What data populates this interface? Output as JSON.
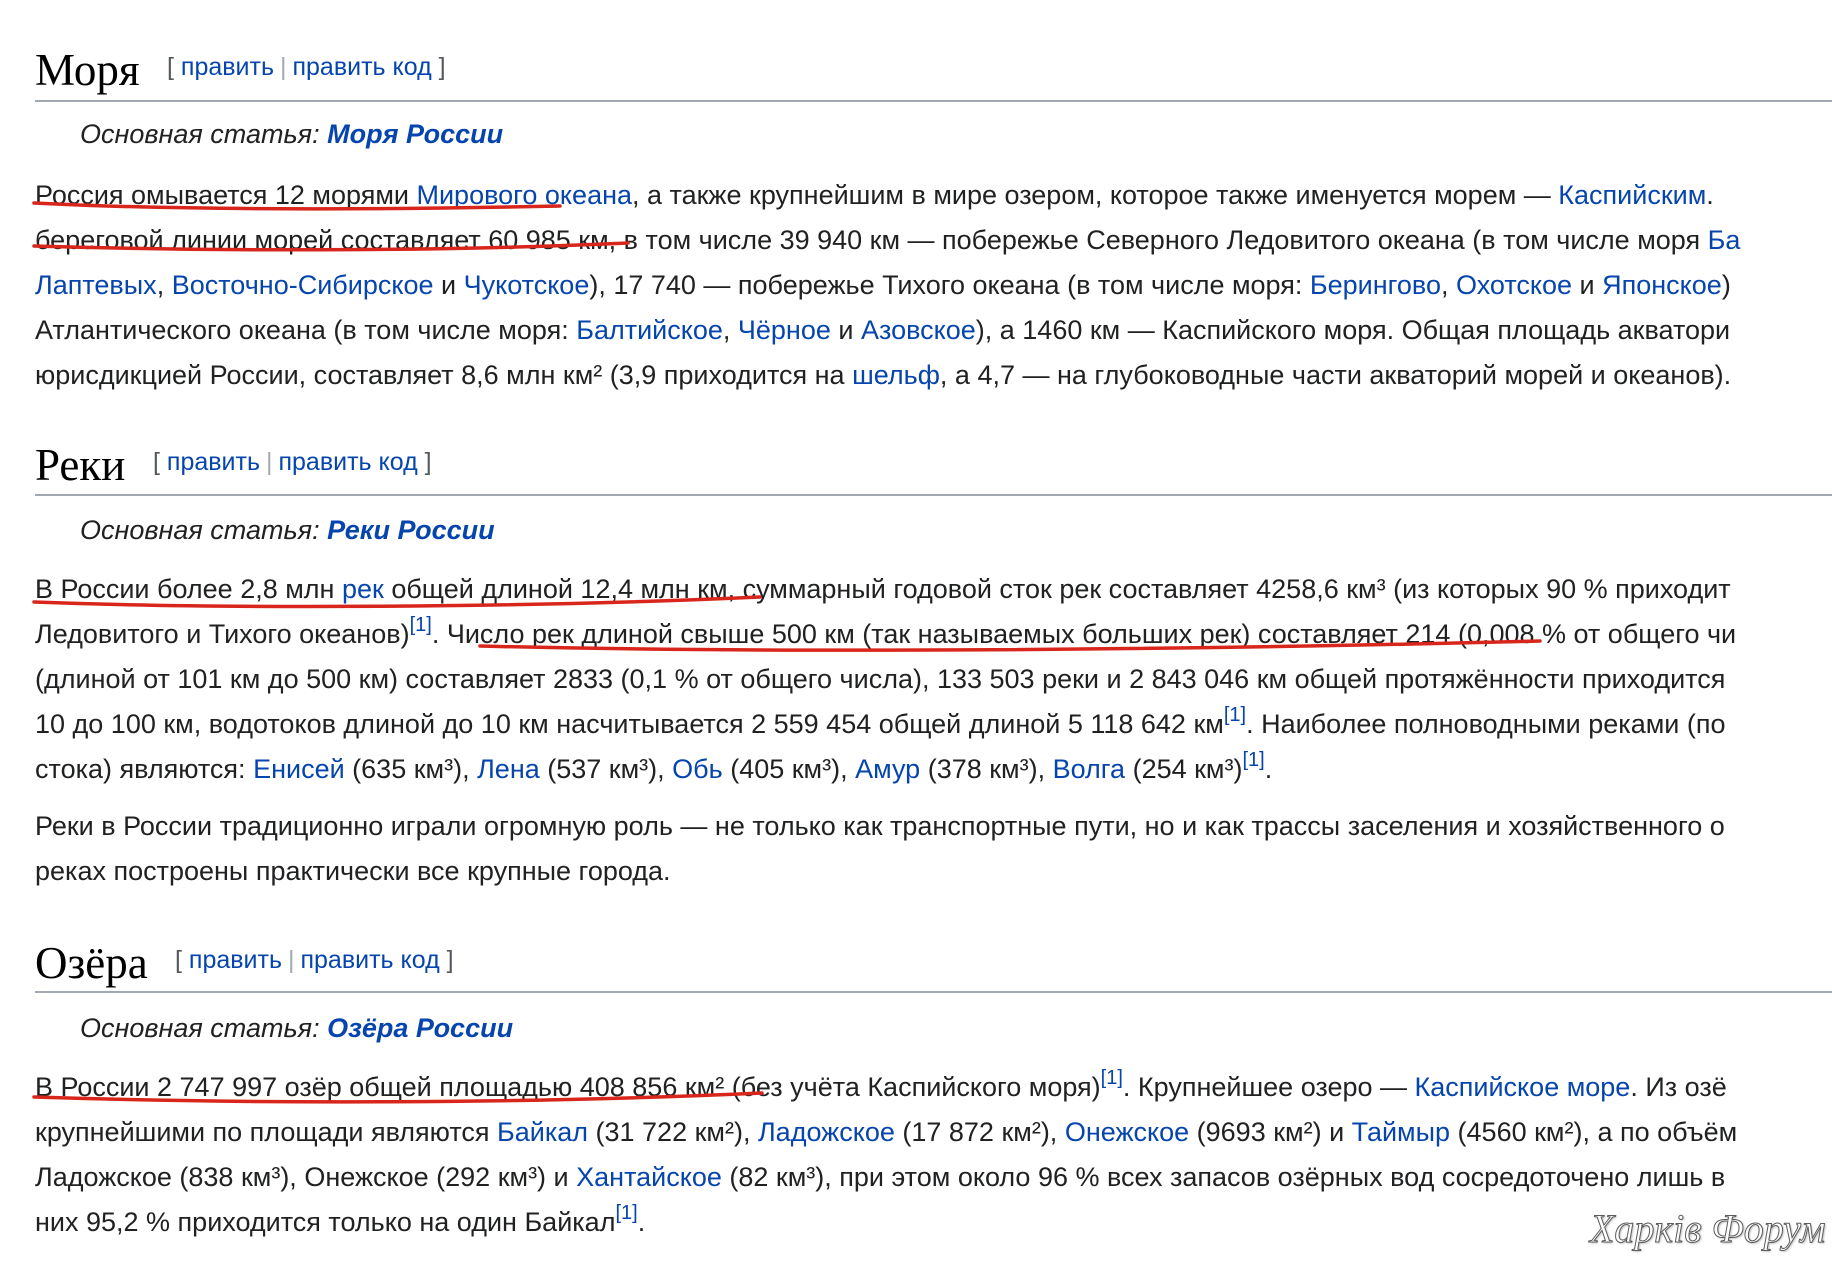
{
  "edit_label": "править",
  "edit_code_label": "править код",
  "main_article_prefix": "Основная статья:",
  "sections": {
    "seas": {
      "title": "Моря",
      "main_article": "Моря России",
      "lines": [
        [
          "Россия омывается 12 морями ",
          "@Мирового океана",
          ", а также крупнейшим в мире озером, которое также именуется морем — ",
          "@Каспийским",
          ". "
        ],
        [
          "береговой линии морей составляет 60 985 км, в том числе 39 940 км — побережье Северного Ледовитого океана (в том числе моря ",
          "@Ба"
        ],
        [
          "@Лаптевых",
          ", ",
          "@Восточно-Сибирское",
          " и ",
          "@Чукотское",
          "), 17 740 — побережье Тихого океана (в том числе моря: ",
          "@Берингово",
          ", ",
          "@Охотское",
          " и ",
          "@Японское",
          ")"
        ],
        [
          "Атлантического океана (в том числе моря: ",
          "@Балтийское",
          ", ",
          "@Чёрное",
          " и ",
          "@Азовское",
          "), а 1460 км — Каспийского моря. Общая площадь акватори"
        ],
        [
          "юрисдикцией России, составляет 8,6 млн км² (3,9 приходится на ",
          "@шельф",
          ", а 4,7 — на глубоководные части акваторий морей и океанов)."
        ]
      ]
    },
    "rivers": {
      "title": "Реки",
      "main_article": "Реки России",
      "lines": [
        [
          "В России более 2,8 млн ",
          "@рек",
          " общей длиной 12,4 млн км, суммарный годовой сток рек составляет 4258,6 км³ (из которых 90 % приходит"
        ],
        [
          "Ледовитого и Тихого океанов)",
          "^[1]",
          ". Число рек длиной свыше 500 км (так называемых больших рек) составляет 214 (0,008 % от общего чи"
        ],
        [
          "(длиной от 101 км до 500 км) составляет 2833 (0,1 % от общего числа), 133 503 реки и 2 843 046 км общей протяжённости приходится"
        ],
        [
          "10 до 100 км, водотоков длиной до 10 км насчитывается 2 559 454 общей длиной 5 118 642 км",
          "^[1]",
          ". Наиболее полноводными реками (по"
        ],
        [
          "стока) являются: ",
          "@Енисей",
          " (635 км³), ",
          "@Лена",
          " (537 км³), ",
          "@Обь",
          " (405 км³), ",
          "@Амур",
          " (378 км³), ",
          "@Волга",
          " (254 км³)",
          "^[1]",
          "."
        ]
      ],
      "lines2": [
        [
          "Реки в России традиционно играли огромную роль — не только как транспортные пути, но и как трассы заселения и хозяйственного о"
        ],
        [
          "реках построены практически все крупные города."
        ]
      ]
    },
    "lakes": {
      "title": "Озёра",
      "main_article": "Озёра России",
      "lines": [
        [
          "В России 2 747 997 озёр общей площадью 408 856 км² (без учёта Каспийского моря)",
          "^[1]",
          ". Крупнейшее озеро — ",
          "@Каспийское море",
          ". Из озё"
        ],
        [
          "крупнейшими по площади являются ",
          "@Байкал",
          " (31 722 км²), ",
          "@Ладожское",
          " (17 872 км²), ",
          "@Онежское",
          " (9693 км²) и ",
          "@Таймыр",
          " (4560 км²), а по объём"
        ],
        [
          "Ладожское (838 км³), Онежское (292 км³) и ",
          "@Хантайское",
          " (82 км³), при этом около 96 % всех запасов озёрных вод сосредоточено лишь в"
        ],
        [
          "них 95,2 % приходится только на один Байкал",
          "^[1]",
          "."
        ]
      ]
    }
  },
  "watermark": "Харків Форум",
  "colors": {
    "link": "#0645ad",
    "text": "#202122",
    "rule": "#a2a9b1",
    "annotation": "#d9261c"
  }
}
